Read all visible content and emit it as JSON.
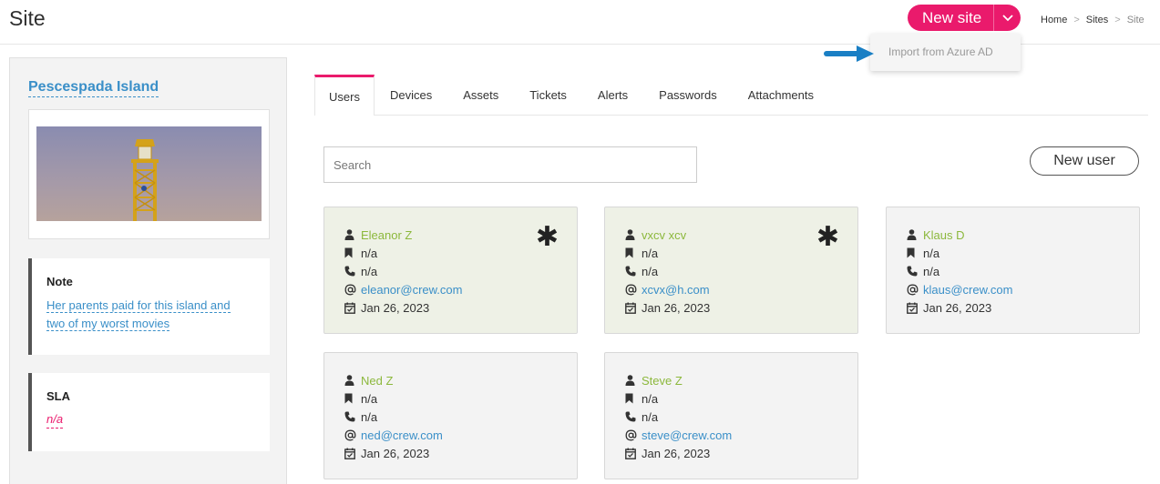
{
  "header": {
    "title": "Site",
    "new_site_label": "New site",
    "breadcrumb": [
      "Home",
      "Sites",
      "Site"
    ],
    "breadcrumb_sep": ">"
  },
  "dropdown": {
    "items": [
      "Import from Azure AD"
    ]
  },
  "sidebar": {
    "site_name": "Pescespada Island",
    "note_title": "Note",
    "note_text_line1": "Her parents paid for this island and",
    "note_text_line2": "two of my worst movies",
    "sla_title": "SLA",
    "sla_value": "n/a"
  },
  "tabs": [
    "Users",
    "Devices",
    "Assets",
    "Tickets",
    "Alerts",
    "Passwords",
    "Attachments"
  ],
  "search": {
    "placeholder": "Search"
  },
  "new_user_label": "New user",
  "users": [
    {
      "name": "Eleanor Z",
      "role": "n/a",
      "phone": "n/a",
      "email": "eleanor@crew.com",
      "date": "Jan 26, 2023",
      "starred": true,
      "star_glyph": "✱"
    },
    {
      "name": "vxcv xcv",
      "role": "n/a",
      "phone": "n/a",
      "email": "xcvx@h.com",
      "date": "Jan 26, 2023",
      "starred": true,
      "star_glyph": "✱"
    },
    {
      "name": "Klaus D",
      "role": "n/a",
      "phone": "n/a",
      "email": "klaus@crew.com",
      "date": "Jan 26, 2023",
      "starred": false
    },
    {
      "name": "Ned Z",
      "role": "n/a",
      "phone": "n/a",
      "email": "ned@crew.com",
      "date": "Jan 26, 2023",
      "starred": false
    },
    {
      "name": "Steve Z",
      "role": "n/a",
      "phone": "n/a",
      "email": "steve@crew.com",
      "date": "Jan 26, 2023",
      "starred": false
    }
  ],
  "colors": {
    "accent": "#ea1a6c",
    "link": "#3a8fc8",
    "name_green": "#8cb83c",
    "card_highlight": "#eef1e6"
  },
  "icons": [
    "user-icon",
    "bookmark-icon",
    "phone-icon",
    "at-icon",
    "calendar-icon",
    "asterisk-icon",
    "chevron-down-icon",
    "arrow-right-icon"
  ]
}
